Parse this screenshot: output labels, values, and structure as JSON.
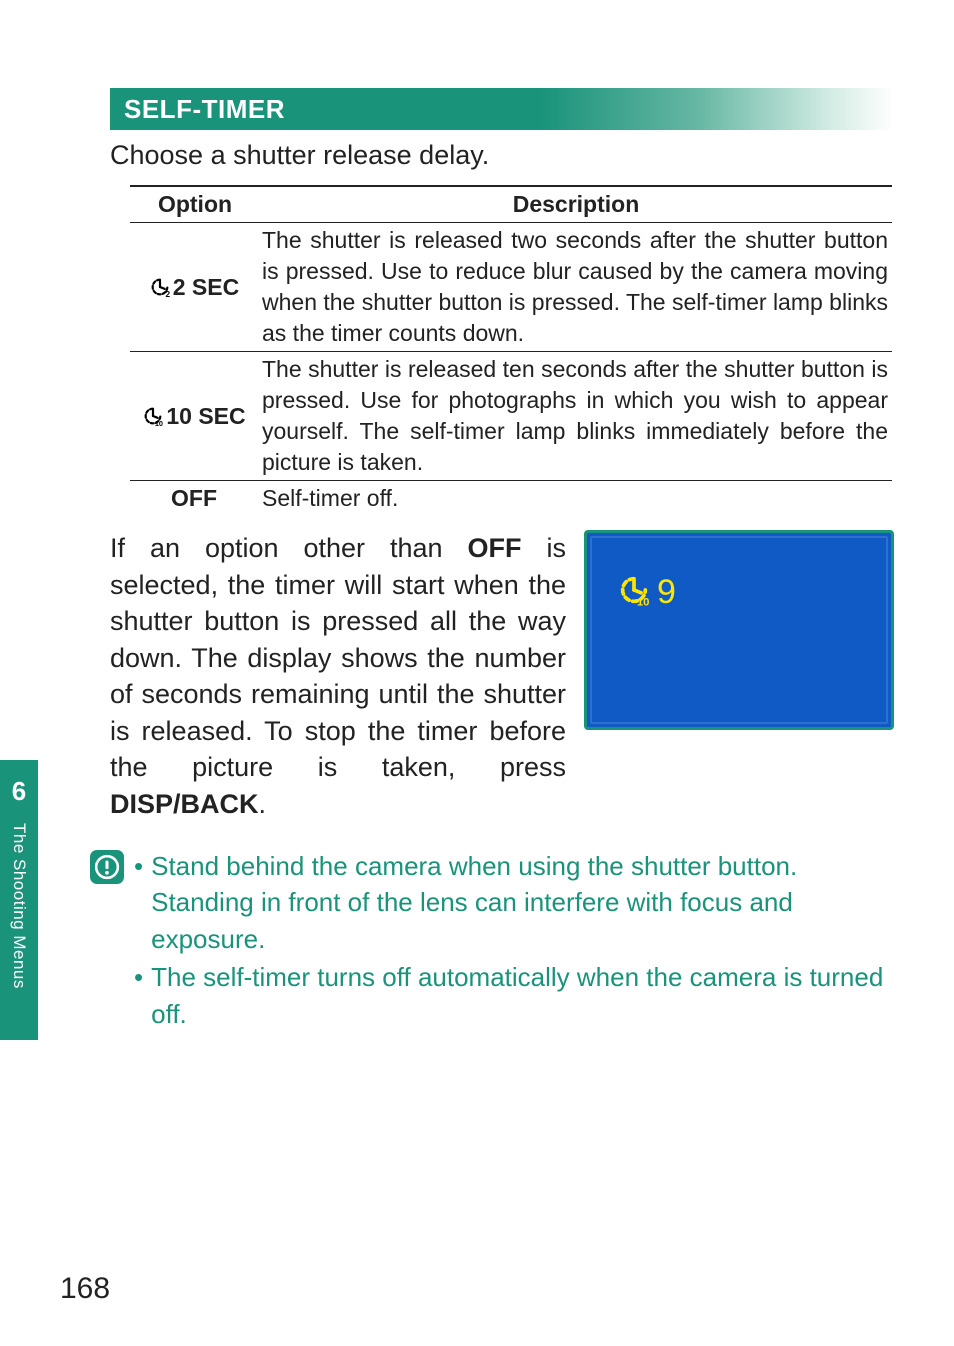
{
  "section_title": "SELF-TIMER",
  "intro": "Choose a shutter release delay.",
  "table": {
    "headers": {
      "option": "Option",
      "description": "Description"
    },
    "rows": [
      {
        "icon": "timer-2-icon",
        "label": "2 SEC",
        "desc": "The shutter is released two seconds after the shutter button is pressed. Use to reduce blur caused by the camera moving when the shutter button is pressed. The self-timer lamp blinks as the timer counts down."
      },
      {
        "icon": "timer-10-icon",
        "label": "10 SEC",
        "desc": "The shutter is released ten seconds after the shutter button is pressed. Use for photographs in which you wish to appear yourself. The self-timer lamp blinks immediately before the picture is taken."
      },
      {
        "icon": null,
        "label": "OFF",
        "desc": "Self-timer off."
      }
    ]
  },
  "under_para": {
    "pre": "If an option other than ",
    "bold1": "OFF",
    "mid": " is selected, the timer will start when the shutter button is pressed all the way down. The display shows the number of seconds remaining until the shutter is released. To stop the timer before the picture is taken, press ",
    "bold2": "DISP/BACK",
    "post": "."
  },
  "viewfinder": {
    "countdown": "9"
  },
  "warnings": [
    "Stand behind the camera when using the shutter button. Standing in front of the lens can interfere with focus and exposure.",
    "The self-timer turns off automatically when the camera is turned off."
  ],
  "side_tab": {
    "number": "6",
    "label": "The Shooting Menus"
  },
  "page_number": "168"
}
